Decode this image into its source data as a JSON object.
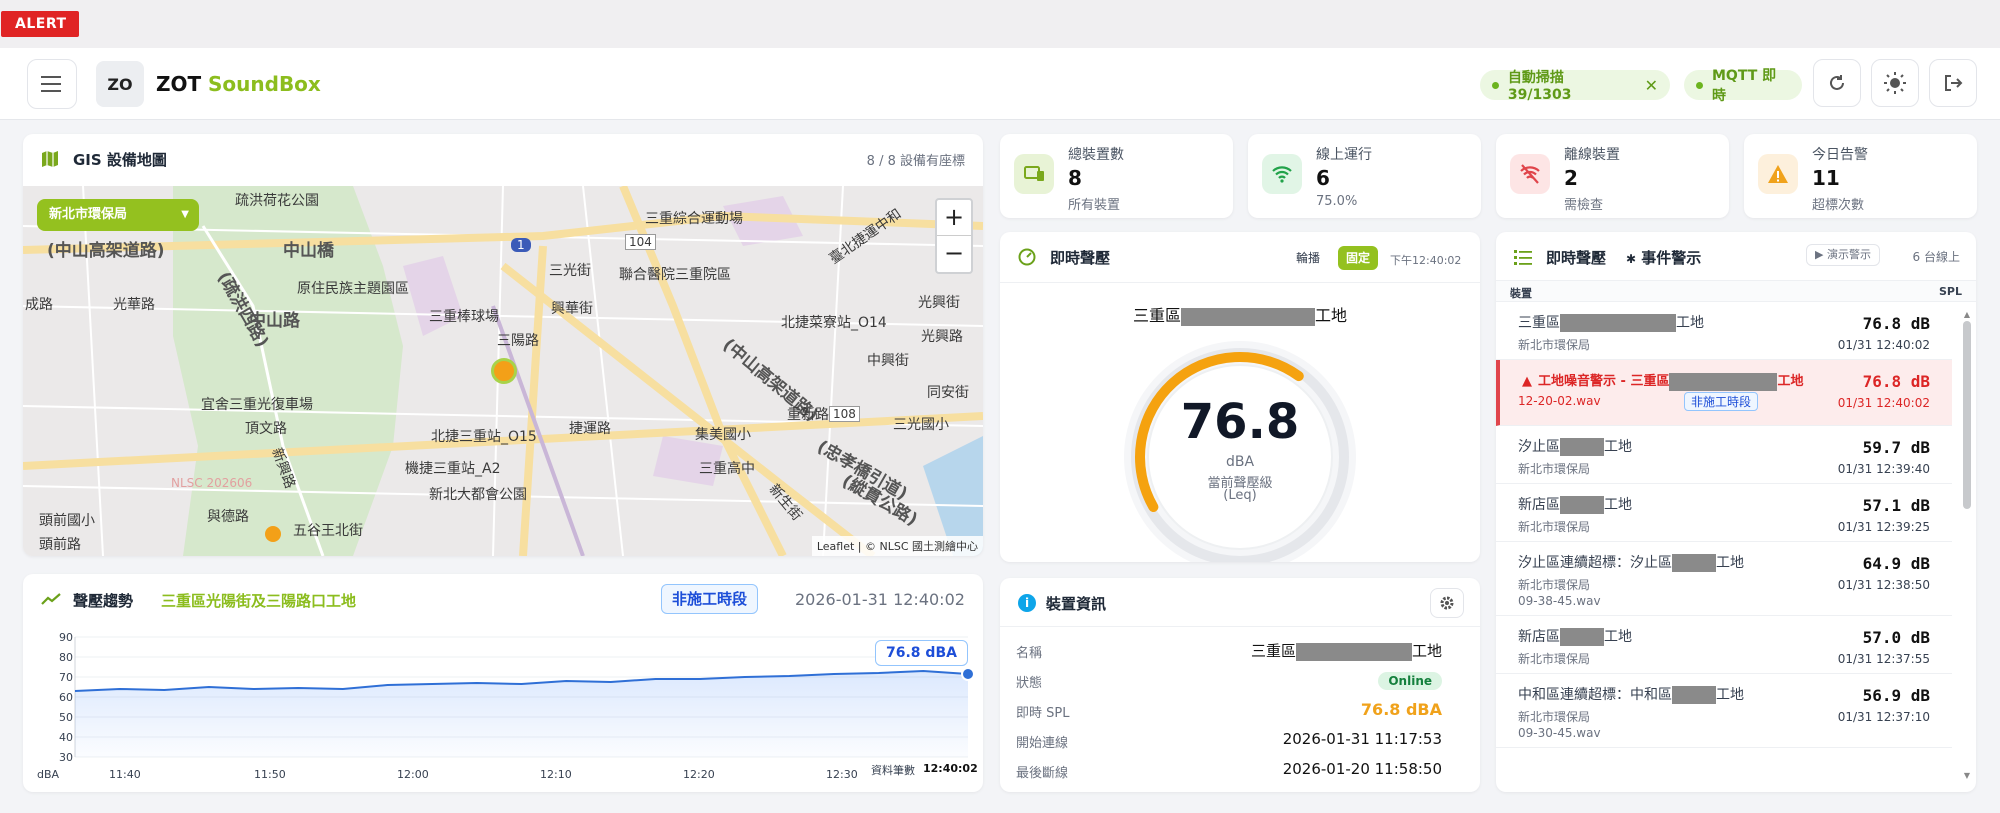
{
  "alert_label": "ALERT",
  "header": {
    "logo_text": "ZO",
    "brand_name": "ZOT",
    "brand_product": "SoundBox",
    "scan_pill": "自動掃描 39/1303",
    "mqtt_pill": "MQTT 即時"
  },
  "gis": {
    "title": "GIS 設備地圖",
    "coords_count": "8 / 8 設備有座標",
    "org_select": "新北市環保局",
    "zoom_in": "+",
    "zoom_out": "−",
    "attribution": "Leaflet | © NLSC 國土測繪中心",
    "map_labels": [
      "疏洪荷花公園",
      "(中山高架道路)",
      "中山橋",
      "(疏洪四路)",
      "原住民族主題園區",
      "三重棒球場",
      "三陽路",
      "中山路",
      "三重綜合運動場",
      "聯合醫院三重院區",
      "三光街",
      "興華街",
      "北捷菜寮站_O14",
      "光興街",
      "(中山高架道路)",
      "宜舍三重光復車場",
      "頂文路",
      "北捷三重站_O15",
      "捷運路",
      "集美國小",
      "三重高中",
      "三光國小",
      "機捷三重站_A2",
      "新北大都會公園",
      "五谷王北街",
      "頭前國小",
      "與德路",
      "頭前路",
      "光華路",
      "成路",
      "新興路",
      "(忠孝橋引道)",
      "(縱貫公路)",
      "臺北捷運中和",
      "重新路",
      "新生街",
      "中興街",
      "同安街",
      "光興路",
      "NLSC 202606",
      "104",
      "108",
      "1"
    ]
  },
  "trend": {
    "title": "聲壓趨勢",
    "site": "三重區光陽街及三陽路口工地",
    "phase_badge": "非施工時段",
    "datetime": "2026-01-31 12:40:02",
    "tooltip": "76.8 dBA",
    "x_axis_end_label": "資料筆數",
    "last_time": "12:40:02"
  },
  "chart_data": {
    "type": "area",
    "title": "",
    "xlabel": "",
    "ylabel": "dBA",
    "ylim": [
      30,
      90
    ],
    "yticks": [
      30,
      40,
      50,
      60,
      70,
      80,
      90
    ],
    "xticks": [
      "11:40",
      "11:50",
      "12:00",
      "12:10",
      "12:20",
      "12:30"
    ],
    "x": [
      "11:40",
      "11:43",
      "11:46",
      "11:49",
      "11:52",
      "11:55",
      "11:58",
      "12:01",
      "12:04",
      "12:07",
      "12:10",
      "12:13",
      "12:16",
      "12:19",
      "12:22",
      "12:25",
      "12:28",
      "12:31",
      "12:34",
      "12:37",
      "12:40"
    ],
    "values": [
      63,
      64,
      63.5,
      65,
      64,
      64.5,
      64,
      66,
      66.5,
      67,
      66.5,
      68,
      67.5,
      69,
      69,
      70,
      70.5,
      71.5,
      72,
      73,
      71.5
    ],
    "grid": true,
    "legend": "none"
  },
  "stats": [
    {
      "label": "總裝置數",
      "value": "8",
      "sub": "所有裝置",
      "color": "#e8f3d6",
      "icon_color": "#7aa81c"
    },
    {
      "label": "線上運行",
      "value": "6",
      "sub": "75.0%",
      "color": "#e1f5e6",
      "icon_color": "#22a24a"
    },
    {
      "label": "離線裝置",
      "value": "2",
      "sub": "需檢查",
      "color": "#fde5e5",
      "icon_color": "#e0454b"
    },
    {
      "label": "今日告警",
      "value": "11",
      "sub": "超標次數",
      "color": "#fdf0dc",
      "icon_color": "#f0a21b"
    }
  ],
  "live": {
    "title": "即時聲壓",
    "btn_rotate": "輪播",
    "btn_fixed": "固定",
    "time": "下午12:40:02",
    "site_prefix": "三重區",
    "site_suffix": "工地",
    "value": "76.8",
    "unit": "dBA",
    "desc1": "當前聲壓級",
    "desc2": "(Leq)",
    "gauge_min": 30,
    "gauge_max": 120,
    "gauge_value": 76.8
  },
  "device": {
    "title": "裝置資訊",
    "rows": [
      {
        "key": "名稱",
        "value_prefix": "三重區",
        "value_suffix": "工地"
      },
      {
        "key": "狀態",
        "value": "Online"
      },
      {
        "key": "即時 SPL",
        "value": "76.8 dBA"
      },
      {
        "key": "開始連線",
        "value": "2026-01-31 11:17:53"
      },
      {
        "key": "最後斷線",
        "value": "2026-01-20 11:58:50"
      }
    ]
  },
  "events": {
    "title": "即時聲壓",
    "title2": "事件警示",
    "demo_btn": "▶ 演示警示",
    "online_count": "6 台線上",
    "col_device": "裝置",
    "col_spl": "SPL",
    "rows": [
      {
        "name_prefix": "三重區",
        "name_suffix": "工地",
        "org": "新北市環保局",
        "val": "76.8  dB",
        "time": "01/31 12:40:02"
      },
      {
        "alert": true,
        "name_prefix": "工地噪音警示 - 三重區",
        "name_suffix": "工地",
        "org": "12-20-02.wav",
        "badge": "非施工時段",
        "val": "76.8  dB",
        "time": "01/31 12:40:02"
      },
      {
        "name_prefix": "汐止區",
        "name_suffix": "工地",
        "org": "新北市環保局",
        "val": "59.7  dB",
        "time": "01/31 12:39:40"
      },
      {
        "name_prefix": "新店區",
        "name_suffix": "工地",
        "org": "新北市環保局",
        "val": "57.1  dB",
        "time": "01/31 12:39:25"
      },
      {
        "name_prefix": "汐止區連續超標：汐止區",
        "name_suffix": "工地",
        "org": "新北市環保局",
        "extra": "09-38-45.wav",
        "val": "64.9  dB",
        "time": "01/31 12:38:50"
      },
      {
        "name_prefix": "新店區",
        "name_suffix": "工地",
        "org": "新北市環保局",
        "val": "57.0  dB",
        "time": "01/31 12:37:55"
      },
      {
        "name_prefix": "中和區連續超標：中和區",
        "name_suffix": "工地",
        "org": "新北市環保局",
        "extra": "09-30-45.wav",
        "val": "56.9  dB",
        "time": "01/31 12:37:10"
      }
    ]
  }
}
